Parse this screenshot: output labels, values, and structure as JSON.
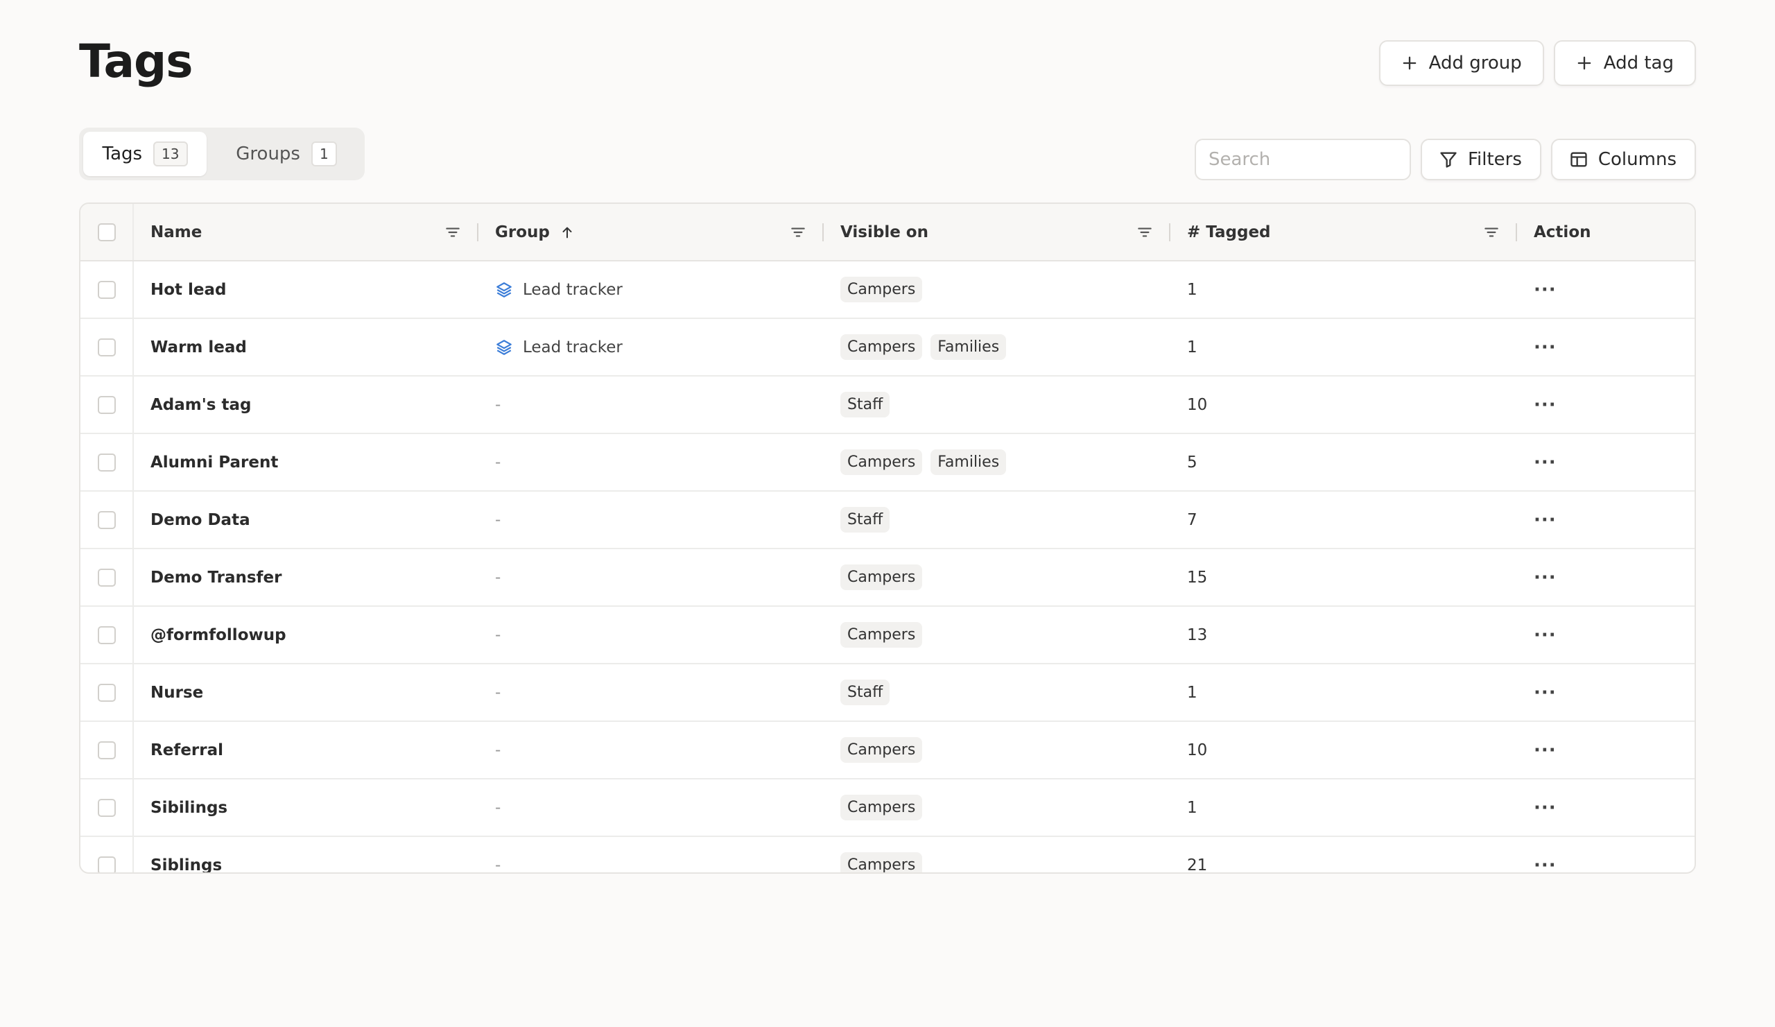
{
  "page": {
    "title": "Tags"
  },
  "header": {
    "add_group_label": "Add group",
    "add_tag_label": "Add tag"
  },
  "tabs": [
    {
      "label": "Tags",
      "count": "13",
      "active": true
    },
    {
      "label": "Groups",
      "count": "1",
      "active": false
    }
  ],
  "toolbar": {
    "search_placeholder": "Search",
    "search_value": "",
    "filters_label": "Filters",
    "columns_label": "Columns"
  },
  "table": {
    "columns": {
      "name": "Name",
      "group": "Group",
      "visible_on": "Visible on",
      "tagged": "# Tagged",
      "action": "Action"
    },
    "rows": [
      {
        "name": "Hot lead",
        "group": "Lead tracker",
        "visible_on": [
          "Campers"
        ],
        "tagged": "1"
      },
      {
        "name": "Warm lead",
        "group": "Lead tracker",
        "visible_on": [
          "Campers",
          "Families"
        ],
        "tagged": "1"
      },
      {
        "name": "Adam's tag",
        "group": "-",
        "visible_on": [
          "Staff"
        ],
        "tagged": "10"
      },
      {
        "name": "Alumni Parent",
        "group": "-",
        "visible_on": [
          "Campers",
          "Families"
        ],
        "tagged": "5"
      },
      {
        "name": "Demo Data",
        "group": "-",
        "visible_on": [
          "Staff"
        ],
        "tagged": "7"
      },
      {
        "name": "Demo Transfer",
        "group": "-",
        "visible_on": [
          "Campers"
        ],
        "tagged": "15"
      },
      {
        "name": "@formfollowup",
        "group": "-",
        "visible_on": [
          "Campers"
        ],
        "tagged": "13"
      },
      {
        "name": "Nurse",
        "group": "-",
        "visible_on": [
          "Staff"
        ],
        "tagged": "1"
      },
      {
        "name": "Referral",
        "group": "-",
        "visible_on": [
          "Campers"
        ],
        "tagged": "10"
      },
      {
        "name": "Sibilings",
        "group": "-",
        "visible_on": [
          "Campers"
        ],
        "tagged": "1"
      },
      {
        "name": "Siblings",
        "group": "-",
        "visible_on": [
          "Campers"
        ],
        "tagged": "21"
      }
    ]
  },
  "colors": {
    "accent_icon": "#3b7dd8",
    "background": "#fbfaf9"
  },
  "icons": {
    "group_icon": "layers-icon",
    "row_action_icon": "more-horizontal-icon",
    "sort_icon": "arrow-up-icon",
    "column_filter_icon": "filter-lines-icon"
  }
}
